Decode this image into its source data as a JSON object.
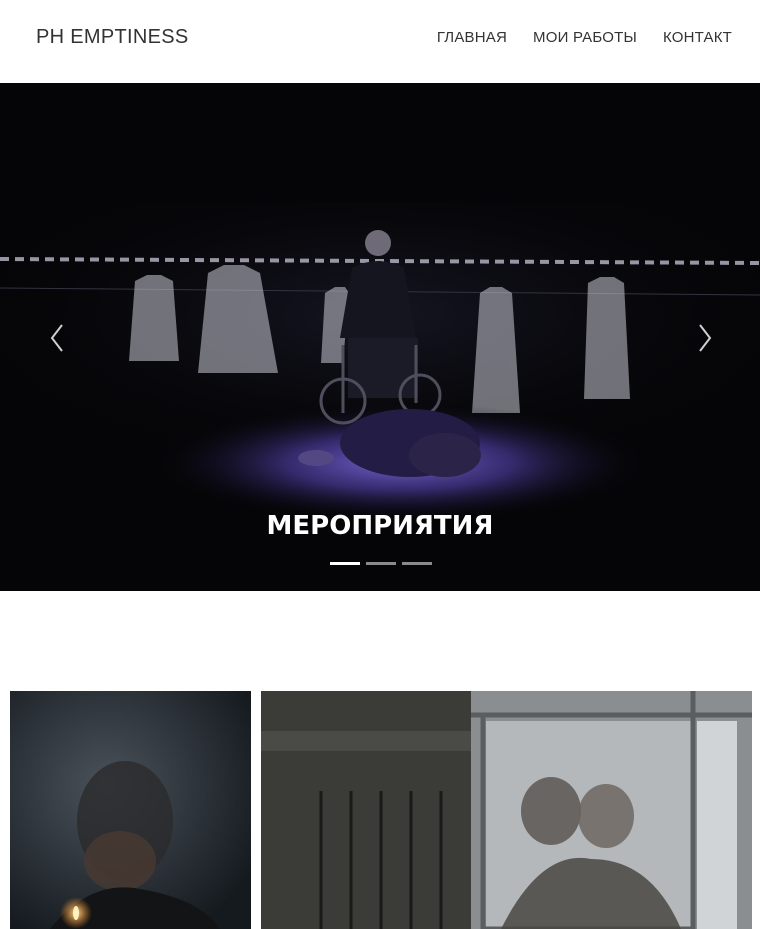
{
  "header": {
    "brand": "PH EMPTINESS",
    "nav": [
      {
        "label": "ГЛАВНАЯ"
      },
      {
        "label": "МОИ РАБОТЫ"
      },
      {
        "label": "КОНТАКТ"
      }
    ]
  },
  "hero": {
    "caption": "МЕРОПРИЯТИЯ",
    "slides_total": 3,
    "active_slide": 1,
    "prev_icon": "chevron-left-icon",
    "next_icon": "chevron-right-icon"
  },
  "gallery": {
    "items": [
      {
        "subject": "man-lighting-cigarette-photo"
      },
      {
        "subject": "couple-behind-glass-photo"
      }
    ]
  },
  "colors": {
    "text": "#333333",
    "hero_bg": "#050507",
    "stage_light": "#6b56c8",
    "dot_active": "#ffffff",
    "dot_inactive": "#8a8a8a"
  }
}
